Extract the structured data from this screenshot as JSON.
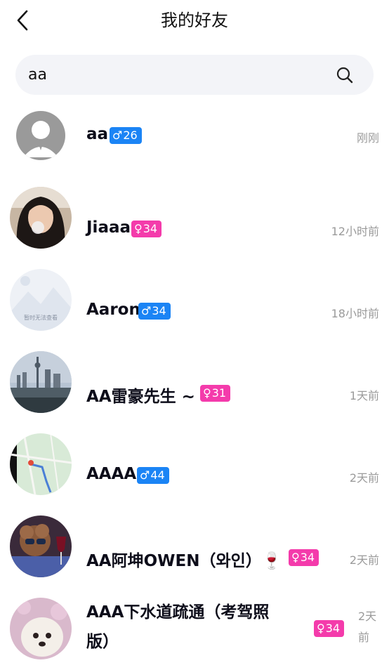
{
  "header": {
    "title": "我的好友"
  },
  "search": {
    "value": "aa"
  },
  "friends": [
    {
      "name": "aa",
      "gender": "♂",
      "age": "26",
      "time": "刚刚"
    },
    {
      "name": "Jiaaa",
      "gender": "♀",
      "age": "34",
      "time": "12小时前"
    },
    {
      "name": "Aaron",
      "gender": "♂",
      "age": "34",
      "time": "18小时前",
      "avatar_caption": "暂时无法查看"
    },
    {
      "name": "AA雷豪先生 ~",
      "gender": "♀",
      "age": "31",
      "time": "1天前"
    },
    {
      "name": "AAAA",
      "gender": "♂",
      "age": "44",
      "time": "2天前"
    },
    {
      "name": "AA阿坤OWEN（와인）🍷",
      "gender": "♀",
      "age": "34",
      "time": "2天前"
    },
    {
      "name": "AAA下水道疏通（考驾照版）",
      "gender": "♀",
      "age": "34",
      "time": "2天前"
    }
  ],
  "colors": {
    "male_badge": "#1b84f5",
    "female_badge": "#f43bab",
    "search_bg": "#f3f4f8"
  }
}
